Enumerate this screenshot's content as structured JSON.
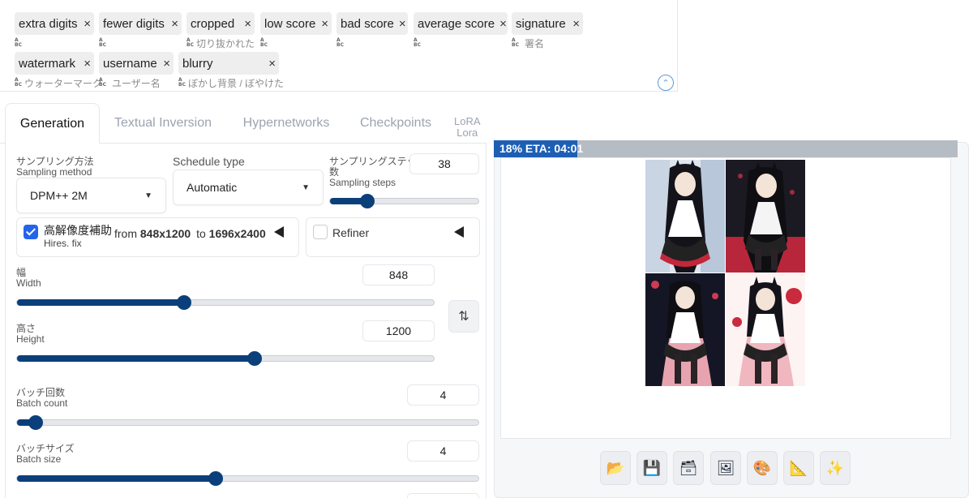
{
  "tags": [
    {
      "label": "extra digits",
      "trans": ""
    },
    {
      "label": "fewer digits",
      "trans": ""
    },
    {
      "label": "cropped",
      "trans": "切り抜かれた"
    },
    {
      "label": "low score",
      "trans": ""
    },
    {
      "label": "bad score",
      "trans": ""
    },
    {
      "label": "average score",
      "trans": ""
    },
    {
      "label": "signature",
      "trans": "署名"
    },
    {
      "label": "watermark",
      "trans": "ウォーターマーク"
    },
    {
      "label": "username",
      "trans": "ユーザー名"
    },
    {
      "label": "blurry",
      "trans": "ぼかし背景 / ぼやけた"
    }
  ],
  "icons": {
    "remove": "×",
    "collapse": "⌃",
    "caret": "▼",
    "swap": "⇅",
    "toolbar": [
      "📂",
      "💾",
      "🗃",
      "🖼",
      "🎨",
      "📐",
      "✨"
    ]
  },
  "tabs": [
    {
      "label": "Generation",
      "active": true
    },
    {
      "label": "Textual Inversion"
    },
    {
      "label": "Hypernetworks"
    },
    {
      "label": "Checkpoints"
    }
  ],
  "tab_lora": {
    "line1": "LoRA",
    "line2": "Lora"
  },
  "sampling_method": {
    "label_jp": "サンプリング方法",
    "label_en": "Sampling method",
    "value": "DPM++ 2M"
  },
  "schedule_type": {
    "label": "Schedule type",
    "value": "Automatic"
  },
  "sampling_steps": {
    "label_jp_1": "サンプリングステップ",
    "label_jp_2": "数",
    "label_en": "Sampling steps",
    "value": "38",
    "fraction": 0.25
  },
  "hires": {
    "checked": true,
    "label_jp": "高解像度補助",
    "label_en": "Hires. fix",
    "from_text": "from",
    "from_value": "848x1200",
    "to_text": "to",
    "to_value": "1696x2400"
  },
  "refiner": {
    "checked": false,
    "label": "Refiner"
  },
  "width": {
    "label_jp": "幅",
    "label_en": "Width",
    "value": "848",
    "fraction": 0.4
  },
  "height": {
    "label_jp": "高さ",
    "label_en": "Height",
    "value": "1200",
    "fraction": 0.57
  },
  "batch_count": {
    "label_jp": "バッチ回数",
    "label_en": "Batch count",
    "value": "4",
    "fraction": 0.04
  },
  "batch_size": {
    "label_jp": "バッチサイズ",
    "label_en": "Batch size",
    "value": "4",
    "fraction": 0.43
  },
  "progress": {
    "text": "18% ETA: 04:01",
    "fraction": 0.18
  },
  "colors": {
    "accent": "#0b3f7a",
    "progress": "#1d5fb5",
    "checkbox": "#2563eb"
  }
}
